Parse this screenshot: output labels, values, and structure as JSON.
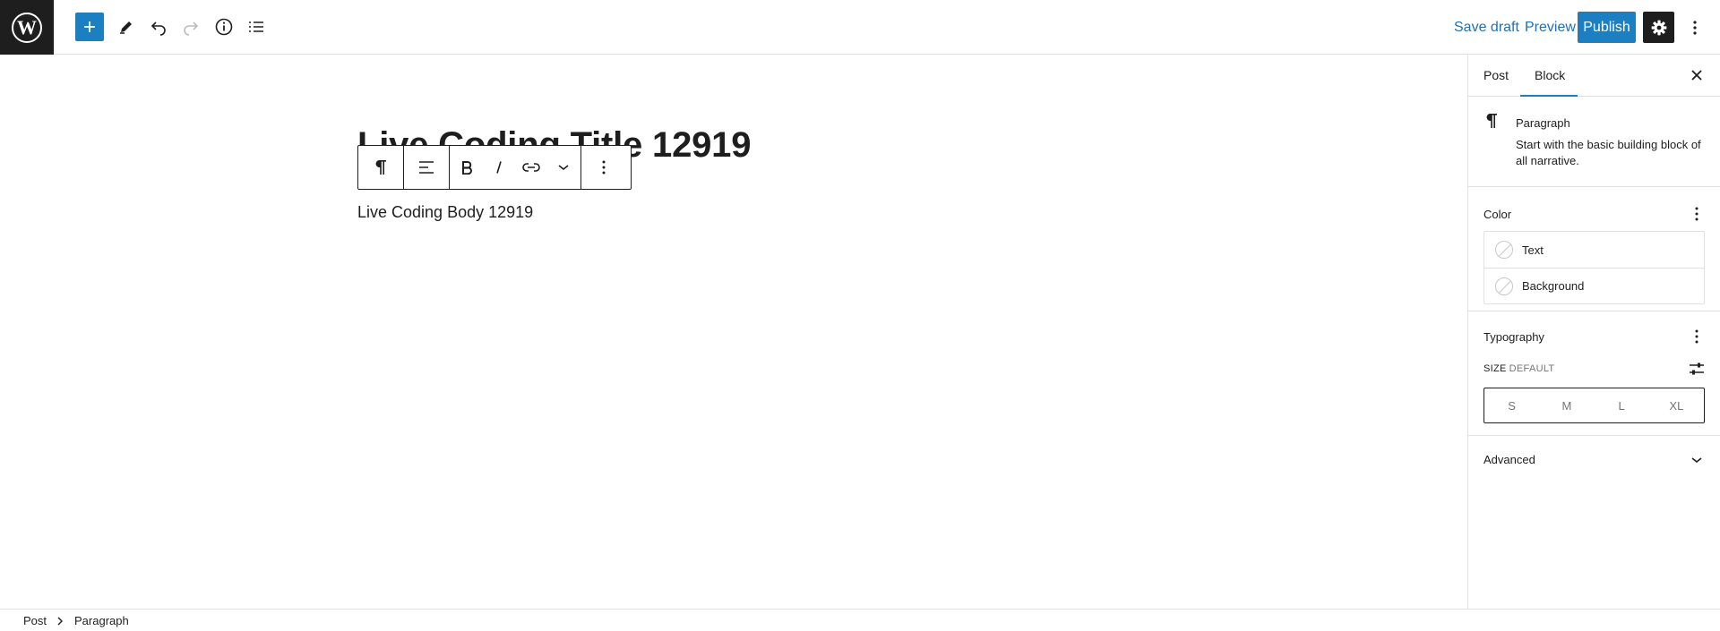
{
  "header": {
    "logo": "wordpress-logo",
    "tools": [
      "add-block-icon",
      "edit-tools-icon",
      "undo-icon",
      "redo-icon",
      "details-info-icon",
      "list-view-icon"
    ],
    "save_draft": "Save draft",
    "preview": "Preview",
    "publish": "Publish"
  },
  "editor": {
    "title": "Live Coding Title 12919",
    "body": "Live Coding Body 12919"
  },
  "sidebar": {
    "tabs": [
      {
        "label": "Post"
      },
      {
        "label": "Block"
      }
    ],
    "active_tab": "Block",
    "block_card": {
      "title": "Paragraph",
      "description": "Start with the basic building block of all narrative."
    },
    "color": {
      "heading": "Color",
      "items": [
        {
          "label": "Text"
        },
        {
          "label": "Background"
        }
      ]
    },
    "typography": {
      "heading": "Typography",
      "size_label": "SIZE",
      "size_value": "DEFAULT",
      "sizes": [
        "S",
        "M",
        "L",
        "XL"
      ]
    },
    "advanced": {
      "heading": "Advanced"
    }
  },
  "breadcrumb": {
    "items": [
      "Post",
      "Paragraph"
    ]
  },
  "colors": {
    "accent": "#1c7fc1",
    "dark": "#1e1e1e",
    "border": "#e0e0e0"
  }
}
